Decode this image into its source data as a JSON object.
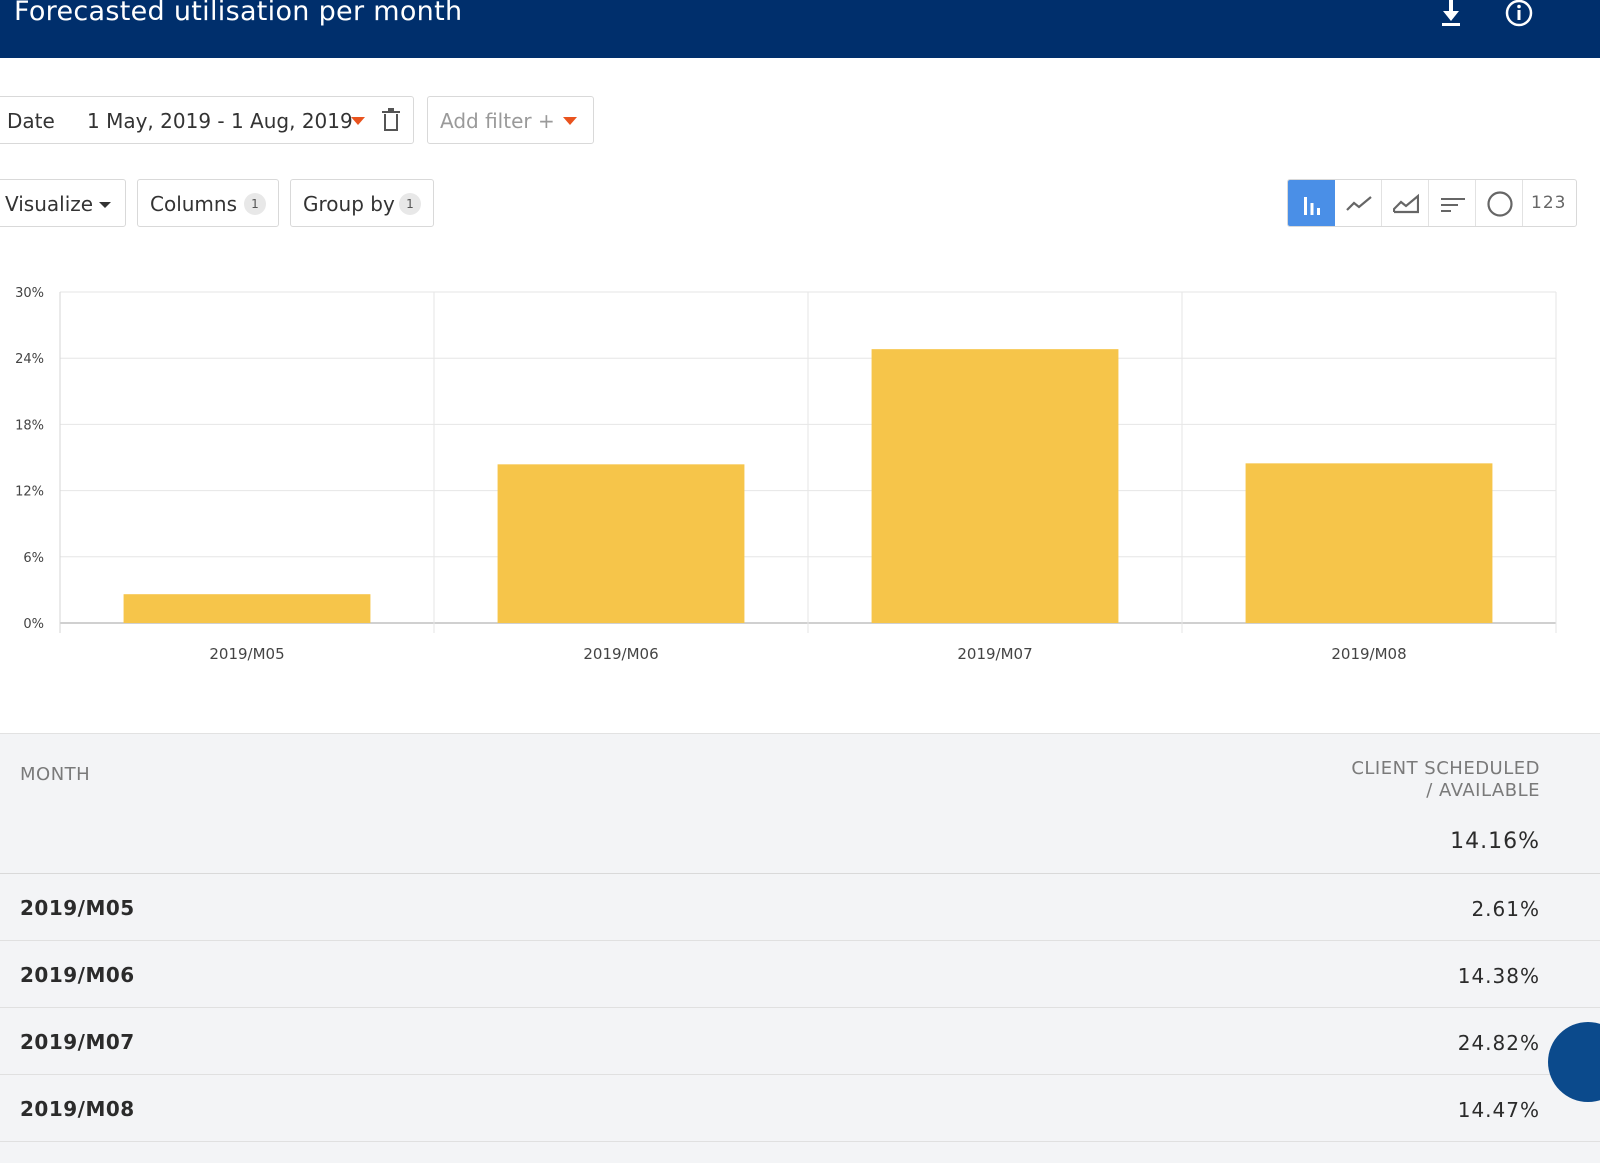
{
  "header": {
    "title": "Forecasted utilisation per month",
    "download_icon": "download-icon",
    "info_icon": "info-icon",
    "background": "#002f6c"
  },
  "filters": {
    "date": {
      "label": "Date",
      "value": "1 May, 2019 - 1 Aug, 2019"
    },
    "add_filter": "Add filter +"
  },
  "toolbar": {
    "visualize": "Visualize",
    "columns": {
      "label": "Columns",
      "count": "1"
    },
    "group_by": {
      "label": "Group by",
      "count": "1"
    },
    "viz_types": [
      {
        "name": "bar-chart-icon",
        "active": true
      },
      {
        "name": "line-chart-icon",
        "active": false
      },
      {
        "name": "area-chart-icon",
        "active": false
      },
      {
        "name": "horizontal-bar-icon",
        "active": false
      },
      {
        "name": "pie-chart-icon",
        "active": false
      },
      {
        "name": "number-display",
        "label": "123",
        "active": false
      }
    ]
  },
  "chart_data": {
    "type": "bar",
    "categories": [
      "2019/M05",
      "2019/M06",
      "2019/M07",
      "2019/M08"
    ],
    "values": [
      2.61,
      14.38,
      24.82,
      14.47
    ],
    "ylim": [
      0,
      30
    ],
    "yticks": [
      "0%",
      "6%",
      "12%",
      "18%",
      "24%",
      "30%"
    ],
    "ytick_values": [
      0,
      6,
      12,
      18,
      24,
      30
    ],
    "bar_color": "#f6c54a",
    "grid": true
  },
  "table": {
    "columns": [
      "MONTH",
      "CLIENT SCHEDULED / AVAILABLE"
    ],
    "total": "14.16%",
    "rows": [
      {
        "month": "2019/M05",
        "value": "2.61%"
      },
      {
        "month": "2019/M06",
        "value": "14.38%"
      },
      {
        "month": "2019/M07",
        "value": "24.82%"
      },
      {
        "month": "2019/M08",
        "value": "14.47%"
      }
    ]
  }
}
